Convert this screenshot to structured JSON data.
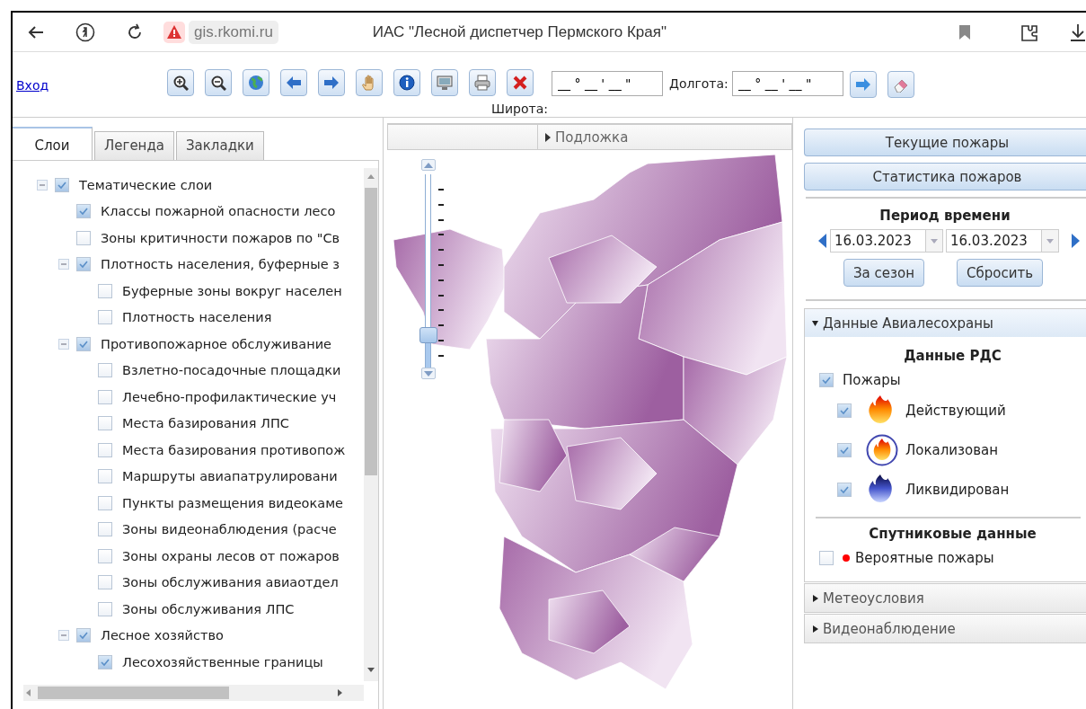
{
  "browser": {
    "url": "gis.rkomi.ru",
    "title": "ИАС \"Лесной диспетчер Пермского Края\""
  },
  "toolbar": {
    "login_link": "Вход",
    "tools": [
      {
        "kind": "zoom-in"
      },
      {
        "kind": "zoom-out"
      },
      {
        "kind": "globe"
      },
      {
        "kind": "back"
      },
      {
        "kind": "forward"
      },
      {
        "kind": "hand"
      },
      {
        "kind": "info"
      },
      {
        "kind": "screen"
      },
      {
        "kind": "print"
      },
      {
        "kind": "clear"
      }
    ],
    "latitude": {
      "label": "Широта:",
      "value": "__ ° __ ' __ \""
    },
    "longitude": {
      "label": "Долгота:",
      "value": "__ ° __ ' __ \""
    }
  },
  "left_panel": {
    "tabs": [
      {
        "label": "Слои",
        "selected": true
      },
      {
        "label": "Легенда",
        "selected": false
      },
      {
        "label": "Закладки",
        "selected": false
      }
    ],
    "tree": [
      {
        "label": "Тематические слои",
        "checked": true,
        "expanded": true,
        "children": [
          {
            "label": "Классы пожарной опасности лесо",
            "checked": true
          },
          {
            "label": "Зоны критичности пожаров по \"Св",
            "checked": false
          },
          {
            "label": "Плотность населения, буферные з",
            "checked": true,
            "expanded": true,
            "children": [
              {
                "label": "Буферные зоны вокруг населен",
                "checked": false
              },
              {
                "label": "Плотность населения",
                "checked": false
              }
            ]
          },
          {
            "label": "Противопожарное обслуживание",
            "checked": true,
            "expanded": true,
            "children": [
              {
                "label": "Взлетно-посадочные площадки",
                "checked": false
              },
              {
                "label": "Лечебно-профилактические уч",
                "checked": false
              },
              {
                "label": "Места базирования ЛПС",
                "checked": false
              },
              {
                "label": "Места базирования противопож",
                "checked": false
              },
              {
                "label": "Маршруты авиапатрулировани",
                "checked": false
              },
              {
                "label": "Пункты размещения видеокаме",
                "checked": false
              },
              {
                "label": "Зоны видеонаблюдения (расче",
                "checked": false
              },
              {
                "label": "Зоны охраны лесов от пожаров",
                "checked": false
              },
              {
                "label": "Зоны обслуживания авиаотдел",
                "checked": false
              },
              {
                "label": "Зоны обслуживания ЛПС",
                "checked": false
              }
            ]
          },
          {
            "label": "Лесное хозяйство",
            "checked": true,
            "expanded": true,
            "children": [
              {
                "label": "Лесохозяйственные границы",
                "checked": true
              }
            ]
          }
        ]
      }
    ]
  },
  "map": {
    "basemap_header": {
      "label": "Подложка",
      "expanded": false
    },
    "zoom": {
      "level": 0.17
    }
  },
  "right_panel": {
    "buttons": [
      "Текущие пожары",
      "Статистика пожаров"
    ],
    "period": {
      "title": "Период времени",
      "from": "16.03.2023",
      "to": "16.03.2023",
      "buttons": [
        "За сезон",
        "Сбросить"
      ]
    },
    "sections": [
      {
        "title": "Данные Авиалесохраны",
        "expanded": true,
        "rds": {
          "title": "Данные РДС",
          "fires": {
            "label": "Пожары",
            "checked": true
          },
          "statuses": [
            {
              "kind": "active",
              "label": "Действующий",
              "checked": true
            },
            {
              "kind": "localized",
              "label": "Локализован",
              "checked": true
            },
            {
              "kind": "extinguished",
              "label": "Ликвидирован",
              "checked": true
            }
          ]
        },
        "satellite": {
          "title": "Спутниковые данные",
          "items": [
            {
              "label": "Вероятные пожары",
              "checked": false,
              "color": "#ff0000"
            }
          ]
        }
      },
      {
        "title": "Метеоусловия",
        "expanded": false
      },
      {
        "title": "Видеонаблюдение",
        "expanded": false
      }
    ]
  }
}
